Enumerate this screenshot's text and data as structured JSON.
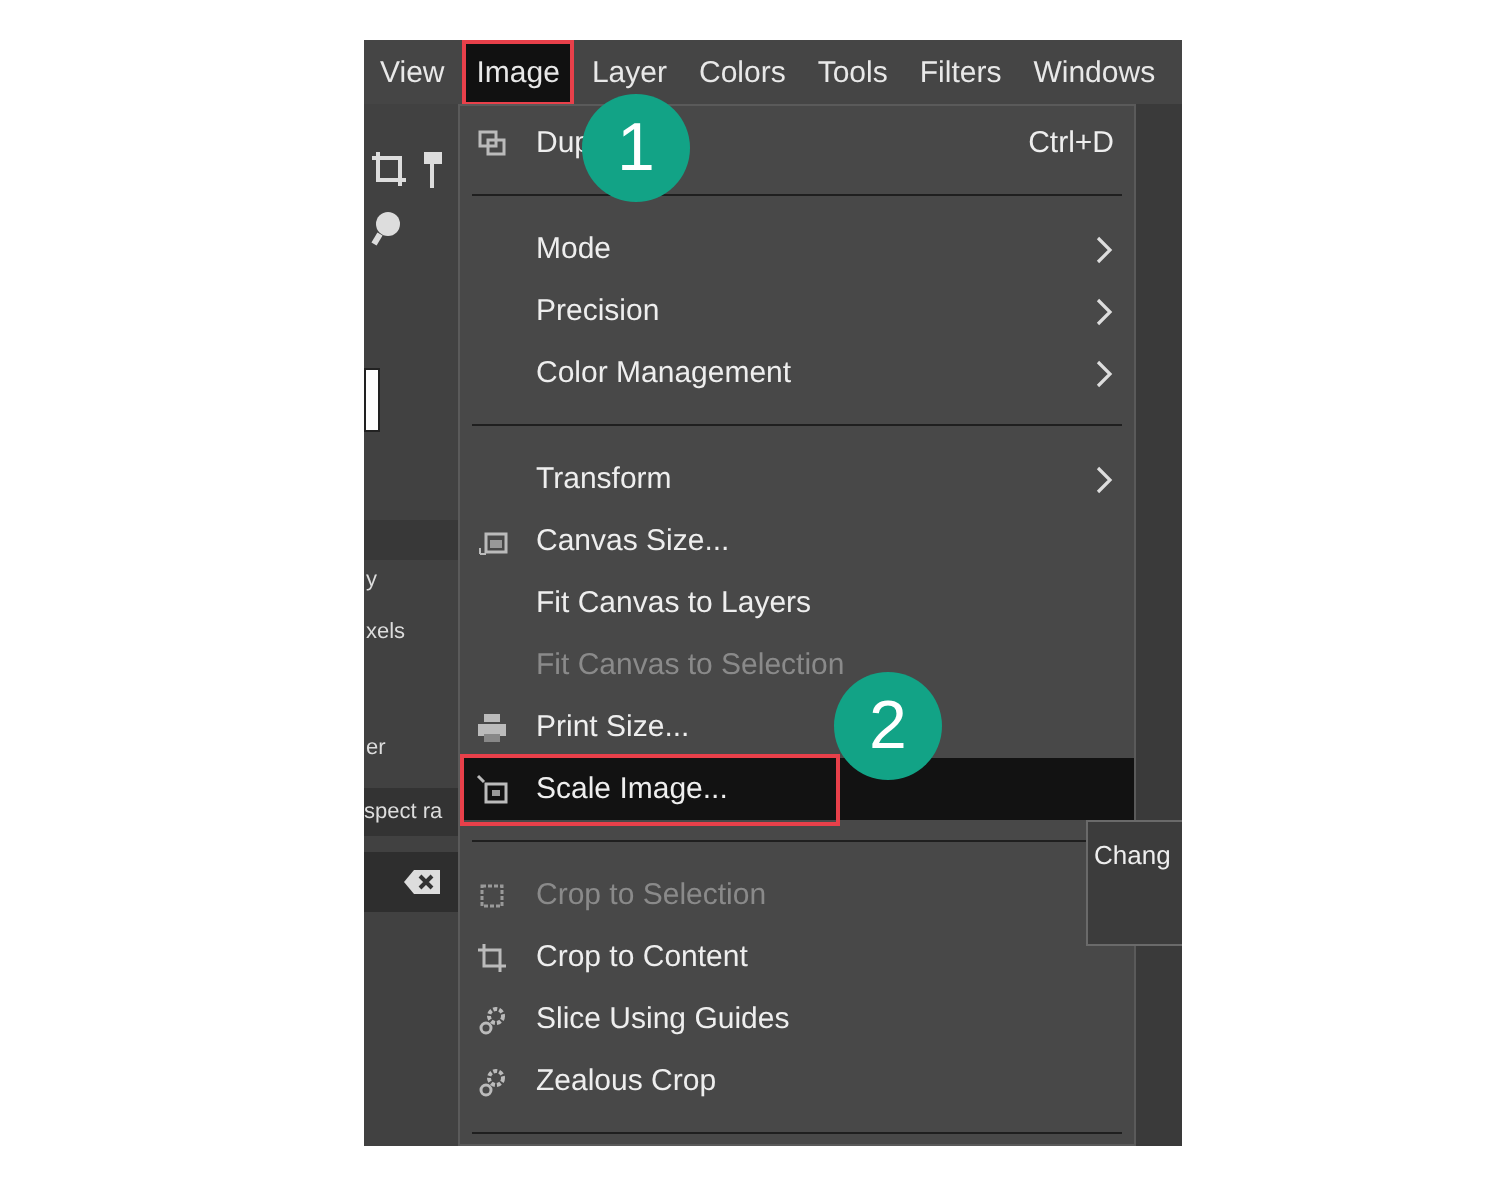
{
  "menubar": [
    {
      "label": "View",
      "selected": false,
      "outlined": false
    },
    {
      "label": "Image",
      "selected": true,
      "outlined": true
    },
    {
      "label": "Layer",
      "selected": false,
      "outlined": false
    },
    {
      "label": "Colors",
      "selected": false,
      "outlined": false
    },
    {
      "label": "Tools",
      "selected": false,
      "outlined": false
    },
    {
      "label": "Filters",
      "selected": false,
      "outlined": false
    },
    {
      "label": "Windows",
      "selected": false,
      "outlined": false
    }
  ],
  "left_panel": {
    "texts": [
      "y",
      "xels",
      "er",
      "spect ra"
    ]
  },
  "menu": [
    {
      "kind": "item",
      "label": "Dup",
      "shortcut": "Ctrl+D",
      "submenu": false,
      "disabled": false,
      "selected": false,
      "outlined": false
    },
    {
      "kind": "separator"
    },
    {
      "kind": "item",
      "label": "Mode",
      "submenu": true,
      "disabled": false,
      "selected": false,
      "outlined": false
    },
    {
      "kind": "item",
      "label": "Precision",
      "submenu": true,
      "disabled": false,
      "selected": false,
      "outlined": false
    },
    {
      "kind": "item",
      "label": "Color Management",
      "submenu": true,
      "disabled": false,
      "selected": false,
      "outlined": false
    },
    {
      "kind": "separator"
    },
    {
      "kind": "item",
      "label": "Transform",
      "submenu": true,
      "disabled": false,
      "selected": false,
      "outlined": false
    },
    {
      "kind": "item",
      "label": "Canvas Size...",
      "submenu": false,
      "disabled": false,
      "selected": false,
      "outlined": false
    },
    {
      "kind": "item",
      "label": "Fit Canvas to Layers",
      "submenu": false,
      "disabled": false,
      "selected": false,
      "outlined": false
    },
    {
      "kind": "item",
      "label": "Fit Canvas to Selection",
      "submenu": false,
      "disabled": true,
      "selected": false,
      "outlined": false
    },
    {
      "kind": "item",
      "label": "Print Size...",
      "submenu": false,
      "disabled": false,
      "selected": false,
      "outlined": false
    },
    {
      "kind": "item",
      "label": "Scale Image...",
      "submenu": false,
      "disabled": false,
      "selected": true,
      "outlined": true
    },
    {
      "kind": "separator"
    },
    {
      "kind": "item",
      "label": "Crop to Selection",
      "submenu": false,
      "disabled": true,
      "selected": false,
      "outlined": false
    },
    {
      "kind": "item",
      "label": "Crop to Content",
      "submenu": false,
      "disabled": false,
      "selected": false,
      "outlined": false
    },
    {
      "kind": "item",
      "label": "Slice Using Guides",
      "submenu": false,
      "disabled": false,
      "selected": false,
      "outlined": false
    },
    {
      "kind": "item",
      "label": "Zealous Crop",
      "submenu": false,
      "disabled": false,
      "selected": false,
      "outlined": false
    },
    {
      "kind": "separator"
    }
  ],
  "tooltip": {
    "text": "Chang"
  },
  "callouts": [
    {
      "label": "1"
    },
    {
      "label": "2"
    }
  ]
}
